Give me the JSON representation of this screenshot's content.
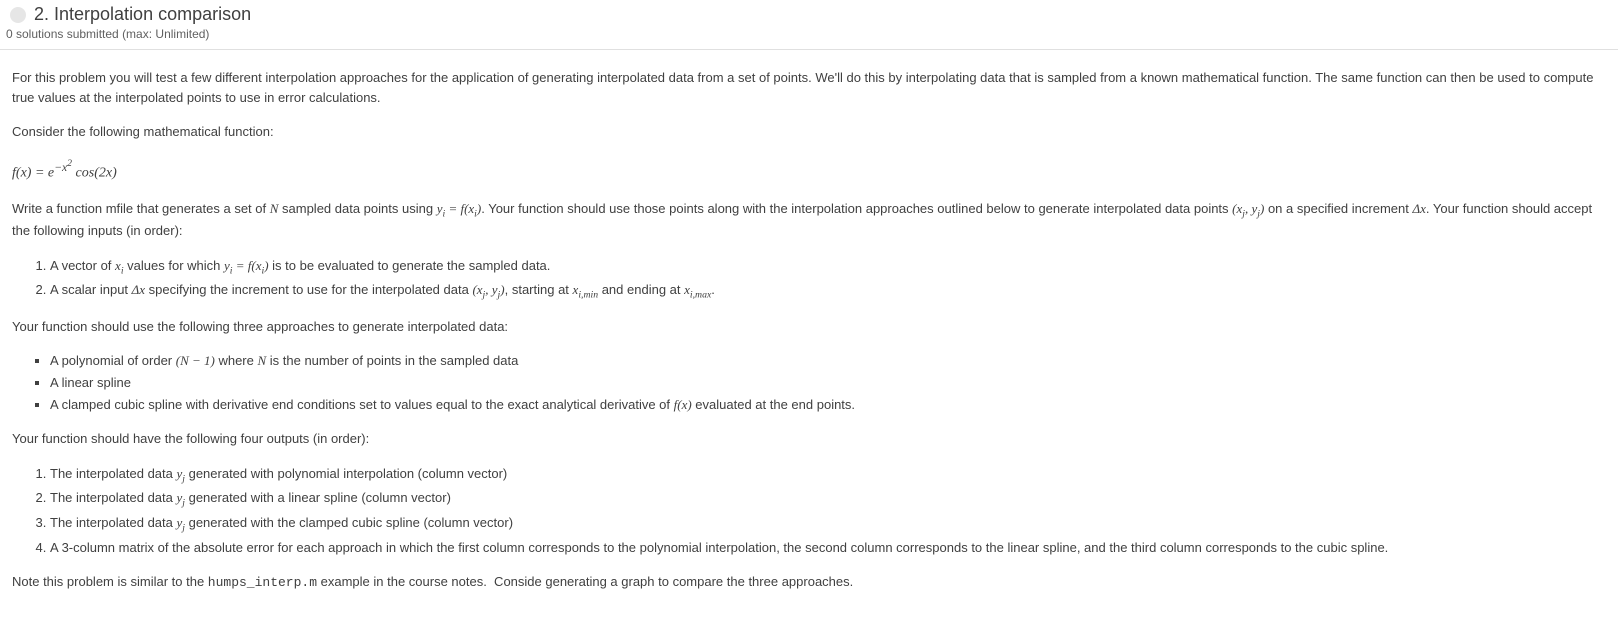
{
  "header": {
    "title": "2. Interpolation comparison",
    "subtitle": "0 solutions submitted (max: Unlimited)"
  },
  "body": {
    "intro": "For this problem you will test a few different interpolation approaches for the application of generating interpolated data from a set of points. We'll do this by interpolating data that is sampled from a known mathematical function. The same function can then be used to compute true values at the interpolated points to use in error calculations.",
    "consider": "Consider the following mathematical function:",
    "equation_html": "<span class='math'>f</span>(<span class='math'>x</span>) = <span class='math'>e</span><sup>&minus;<span class='math'>x</span><sup>2</sup></sup> cos(2<span class='math'>x</span>)",
    "write_html": "Write a function mfile that generates a set of <span class='math'>N</span> sampled data points using <span class='math nowrap'>y<sub>i</sub> = f(x<sub>i</sub>)</span>. Your function should use those points along with the interpolation approaches outlined below to generate interpolated data points <span class='math nowrap'>(x<sub>j</sub>, y<sub>j</sub>)</span> on a specified increment <span class='math nowrap'>&Delta;x</span>. Your function should accept the following inputs (in order):",
    "inputs": [
      "A vector of <span class='math'>x<sub>i</sub></span> values for which <span class='math nowrap'>y<sub>i</sub> = f(x<sub>i</sub>)</span> is to be evaluated to generate the sampled data.",
      "A scalar input <span class='math nowrap'>&Delta;x</span> specifying the increment to use for the interpolated data <span class='math nowrap'>(x<sub>j</sub>, y<sub>j</sub>)</span>, starting at <span class='math nowrap'>x<sub>i,min</sub></span> and ending at <span class='math nowrap'>x<sub>i,max</sub></span>."
    ],
    "approaches_lead": "Your function should use the following three approaches to generate interpolated data:",
    "approaches": [
      "A polynomial of order <span class='math nowrap'>(N &minus; 1)</span> where <span class='math'>N</span> is the number of points in the sampled data",
      "A linear spline",
      "A clamped cubic spline with derivative end conditions set to values equal to the exact analytical derivative of <span class='math nowrap'>f(x)</span> evaluated at the end points."
    ],
    "outputs_lead": "Your function should have the following four outputs (in order):",
    "outputs": [
      "The interpolated data <span class='math'>y<sub>j</sub></span> generated with polynomial interpolation (column vector)",
      "The interpolated data <span class='math'>y<sub>j</sub></span> generated with a linear spline (column vector)",
      "The interpolated data <span class='math'>y<sub>j</sub></span> generated with the clamped cubic spline (column vector)",
      "A 3-column matrix of the absolute error for each approach in which the first column corresponds to the polynomial interpolation, the second column corresponds to the linear spline, and the third column corresponds to the cubic spline."
    ],
    "note_html": "Note this problem is similar to the <code class='mono'>humps_interp.m</code> example in the course notes.&nbsp; Conside generating a graph to compare the three approaches."
  }
}
